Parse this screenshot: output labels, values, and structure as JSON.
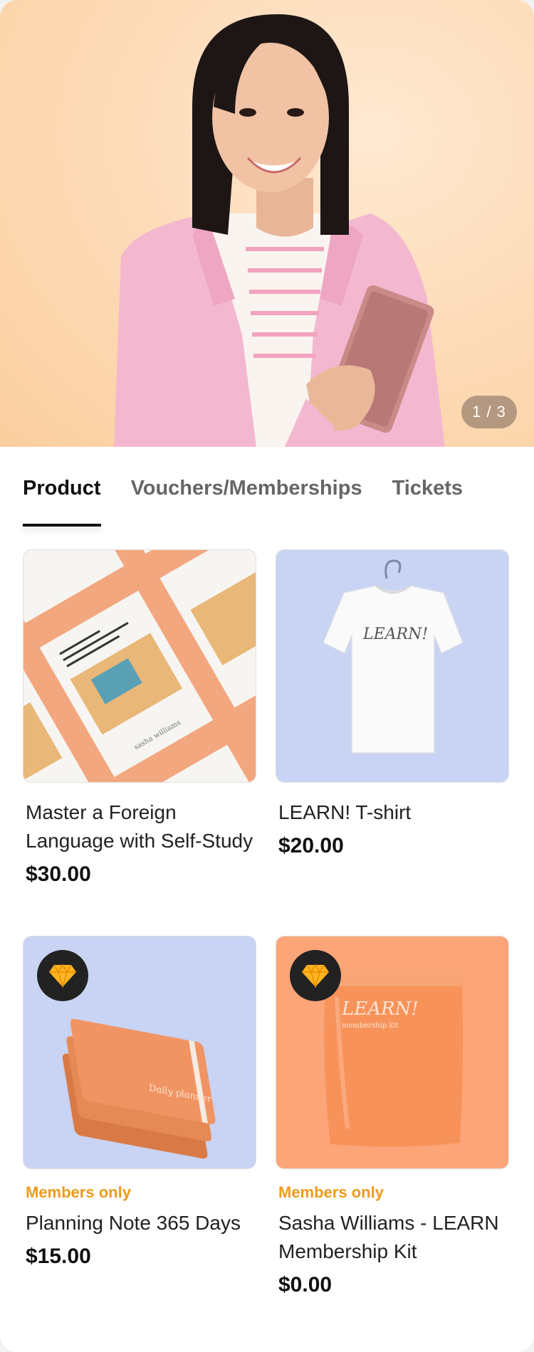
{
  "hero": {
    "pager": "1 / 3"
  },
  "tabs": [
    {
      "label": "Product",
      "active": true
    },
    {
      "label": "Vouchers/Memberships",
      "active": false
    },
    {
      "label": "Tickets",
      "active": false
    }
  ],
  "products": [
    {
      "name": "Master a Foreign Language with Self-Study",
      "price": "$30.00",
      "badge": ""
    },
    {
      "name": "LEARN! T-shirt",
      "price": "$20.00",
      "badge": ""
    },
    {
      "name": "Planning Note 365 Days",
      "price": "$15.00",
      "badge": "Members only",
      "icon": "diamond-icon"
    },
    {
      "name": "Sasha Williams - LEARN Membership Kit",
      "price": "$0.00",
      "badge": "Members only",
      "icon": "diamond-icon"
    }
  ],
  "thumb_text": {
    "tshirt_print": "LEARN!",
    "kit_print": "LEARN!",
    "kit_sub": "membership kit",
    "planner_print": "Daily planner",
    "book_author": "sasha williams"
  },
  "colors": {
    "accent_badge": "#ee9b1c",
    "hero_bg": "#fddcba",
    "blue_bg": "#c9d3f3",
    "orange_bg": "#fca579"
  }
}
